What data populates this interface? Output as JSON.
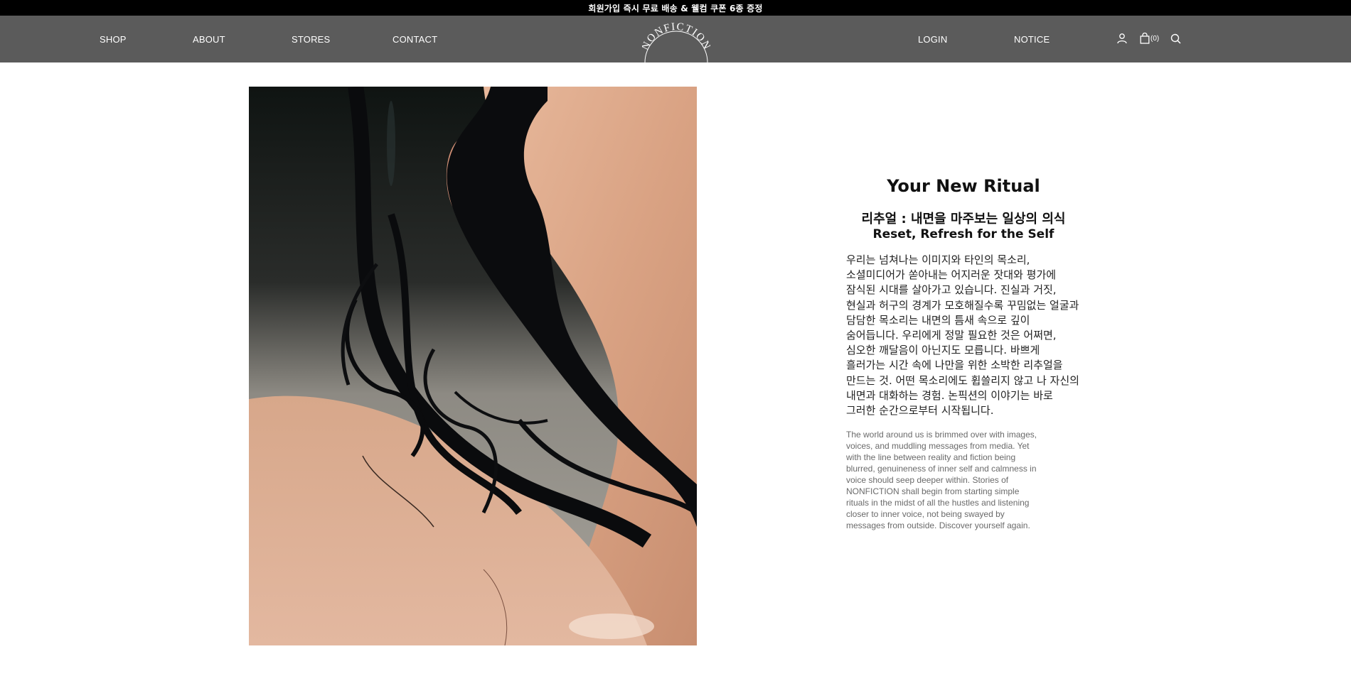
{
  "announcement": {
    "text": "회원가입 즉시 무료 배송 & 웰컴 쿠폰 6종 증정"
  },
  "header": {
    "nav_left": [
      {
        "label": "SHOP"
      },
      {
        "label": "ABOUT"
      },
      {
        "label": "STORES"
      },
      {
        "label": "CONTACT"
      }
    ],
    "logo_text": "NONFICTION",
    "nav_right": [
      {
        "label": "LOGIN"
      },
      {
        "label": "NOTICE"
      }
    ],
    "icons": {
      "account": "user-icon",
      "cart": "shopping-bag-icon",
      "search": "search-icon"
    },
    "cart_count": "(0)",
    "colors": {
      "header_bg": "#5b5b5b",
      "topbar_bg": "#000000"
    }
  },
  "hero": {
    "image_subject": "photo-neck-wet-hair",
    "title": "Your New Ritual",
    "subtitle_kr": "리추얼 : 내면을 마주보는 일상의 의식",
    "subtitle_en": "Reset, Refresh for the Self",
    "body_kr": "우리는 넘쳐나는 이미지와 타인의 목소리,\n소셜미디어가 쏟아내는 어지러운 잣대와 평가에\n잠식된 시대를 살아가고 있습니다. 진실과 거짓,\n현실과 허구의 경계가 모호해질수록 꾸밈없는 얼굴과\n담담한 목소리는 내면의 틈새 속으로 깊이\n숨어듭니다. 우리에게 정말 필요한 것은 어쩌면,\n심오한 깨달음이 아닌지도 모릅니다. 바쁘게\n흘러가는 시간 속에 나만을 위한 소박한 리추얼을\n만드는 것. 어떤 목소리에도 휩쓸리지 않고 나 자신의\n내면과 대화하는 경험. 논픽션의 이야기는 바로\n그러한 순간으로부터 시작됩니다.",
    "body_en": "The world around us is brimmed over with images,\nvoices, and muddling messages from media. Yet\nwith the line between reality and fiction being\nblurred, genuineness of inner self and calmness in\nvoice should seep deeper within. Stories of\nNONFICTION shall begin from starting simple\nrituals in the midst of all the hustles and listening\ncloser to inner voice, not being swayed by\nmessages from outside. Discover yourself again."
  }
}
